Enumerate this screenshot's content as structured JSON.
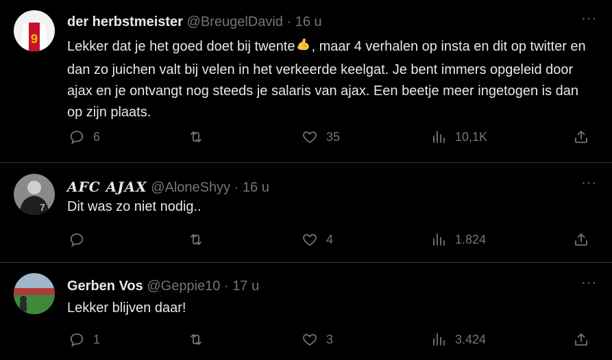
{
  "tweets": [
    {
      "name": "der herbstmeister",
      "handle": "@BreugelDavid",
      "dot": "·",
      "time": "16 u",
      "text_before": "Lekker dat je het goed doet bij twente",
      "emoji": "flexed-biceps",
      "text_after": ", maar 4 verhalen op insta en dit op twitter en dan zo juichen valt bij velen in het verkeerde keelgat. Je bent immers opgeleid door ajax en je ontvangt nog steeds je salaris van ajax. Een beetje meer ingetogen is dan op zijn plaats.",
      "replies": "6",
      "retweets": "",
      "likes": "35",
      "views": "10,1K"
    },
    {
      "name": "𝑨𝑭𝑪 𝑨𝑱𝑨𝑿",
      "handle": "@AloneShyy",
      "dot": "·",
      "time": "16 u",
      "text": "Dit was zo niet nodig..",
      "replies": "",
      "retweets": "",
      "likes": "4",
      "views": "1.824"
    },
    {
      "name": "Gerben Vos",
      "handle": "@Geppie10",
      "dot": "·",
      "time": "17 u",
      "text": "Lekker blijven daar!",
      "replies": "1",
      "retweets": "",
      "likes": "3",
      "views": "3.424"
    }
  ],
  "more_label": "···",
  "colors": {
    "background": "#000000",
    "text": "#e7e9ea",
    "muted": "#71767b",
    "divider": "#2f3336"
  }
}
